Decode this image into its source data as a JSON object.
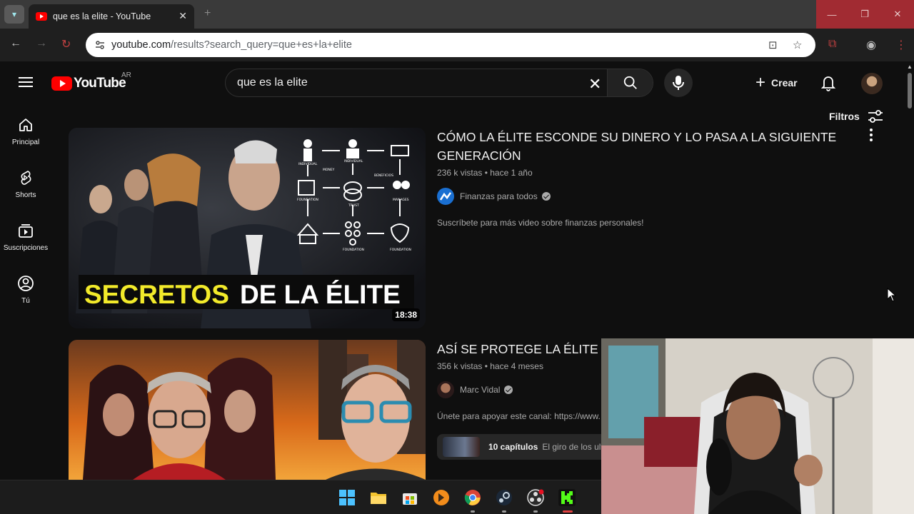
{
  "browser": {
    "tab_title": "que es la elite - YouTube",
    "url_host": "youtube.com",
    "url_path": "/results?search_query=que+es+la+elite"
  },
  "youtube": {
    "logo_text": "YouTube",
    "country_code": "AR",
    "search_value": "que es la elite",
    "create_label": "Crear",
    "filters_label": "Filtros"
  },
  "sidebar": {
    "items": [
      {
        "label": "Principal",
        "icon": "home-icon"
      },
      {
        "label": "Shorts",
        "icon": "shorts-icon"
      },
      {
        "label": "Suscripciones",
        "icon": "subscriptions-icon"
      },
      {
        "label": "Tú",
        "icon": "you-icon"
      }
    ]
  },
  "results": [
    {
      "title": "CÓMO LA ÉLITE ESCONDE SU DINERO Y LO PASA A LA SIGUIENTE GENERACIÓN",
      "stats": "236 k vistas • hace 1 año",
      "channel": "Finanzas para todos",
      "description": "Suscríbete para más video sobre finanzas personales!",
      "duration": "18:38",
      "thumb_caption_a": "SECRETOS",
      "thumb_caption_b": "DE LA ÉLITE",
      "thumb_diagram_labels": [
        "INDIVIDUAL",
        "MONEY",
        "INDIVIDUAL",
        "BENEFICIOS",
        "FOUNDATION",
        "TRUST",
        "MANAGES",
        "FOUNDATION",
        "FOUNDATION"
      ]
    },
    {
      "title": "ASÍ SE PROTEGE LA ÉLITE ¿C",
      "stats": "356 k vistas • hace 4 meses",
      "channel": "Marc Vidal",
      "description": "Únete para apoyar este canal: https://www.",
      "chapters_count": "10 capítulos",
      "chapters_title": "El giro de los ultr"
    }
  ],
  "colors": {
    "accent": "#ff0000",
    "background": "#0f0f0f",
    "secondary_text": "#aaaaaa",
    "caption_yellow": "#f2ea2a"
  }
}
